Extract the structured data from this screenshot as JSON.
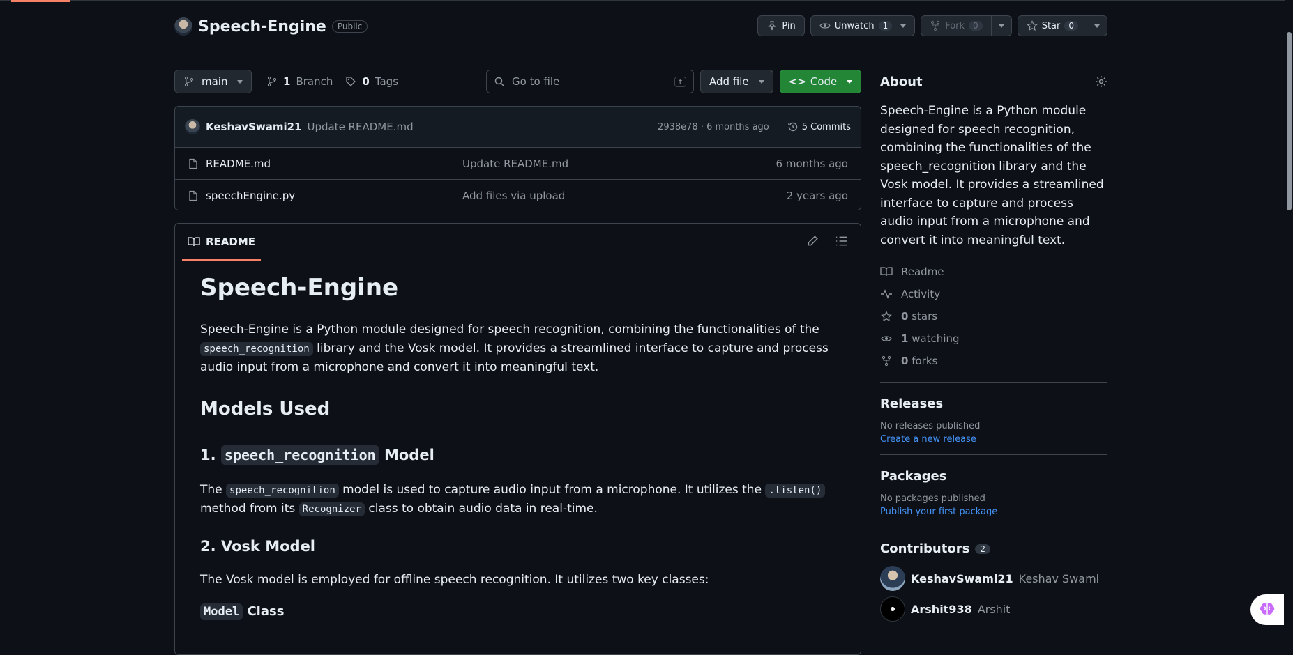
{
  "repo": {
    "name": "Speech-Engine",
    "visibility": "Public",
    "actions": {
      "pin": "Pin",
      "unwatch": "Unwatch",
      "watch_count": "1",
      "fork": "Fork",
      "fork_count": "0",
      "star": "Star",
      "star_count": "0"
    }
  },
  "toolbar": {
    "branch": "main",
    "branch_count": "1",
    "branch_label": "Branch",
    "tag_count": "0",
    "tag_label": "Tags",
    "goto_placeholder": "Go to file",
    "goto_shortcut": "t",
    "add_file": "Add file",
    "code": "Code"
  },
  "latest_commit": {
    "author": "KeshavSwami21",
    "message": "Update README.md",
    "sha_time": "2938e78 · 6 months ago",
    "commits": "5 Commits"
  },
  "files": [
    {
      "name": "README.md",
      "message": "Update README.md",
      "time": "6 months ago"
    },
    {
      "name": "speechEngine.py",
      "message": "Add files via upload",
      "time": "2 years ago"
    }
  ],
  "readme": {
    "tab": "README",
    "h1": "Speech-Engine",
    "intro_1": "Speech-Engine is a Python module designed for speech recognition, combining the functionalities of the",
    "intro_code": "speech_recognition",
    "intro_2": " library and the Vosk model. It provides a streamlined interface to capture and process audio input from a microphone and convert it into meaningful text.",
    "h2_models": "Models Used",
    "h3_1_prefix": "1. ",
    "h3_1_code": "speech_recognition",
    "h3_1_suffix": " Model",
    "p1_a": "The ",
    "p1_code1": "speech_recognition",
    "p1_b": " model is used to capture audio input from a microphone. It utilizes the ",
    "p1_code2": ".listen()",
    "p1_c": " method from its ",
    "p1_code3": "Recognizer",
    "p1_d": " class to obtain audio data in real-time.",
    "h3_2": "2. Vosk Model",
    "p2": "The Vosk model is employed for offline speech recognition. It utilizes two key classes:",
    "h4_code": "Model",
    "h4_suffix": " Class"
  },
  "sidebar": {
    "about_title": "About",
    "about_desc": "Speech-Engine is a Python module designed for speech recognition, combining the functionalities of the speech_recognition library and the Vosk model. It provides a streamlined interface to capture and process audio input from a microphone and convert it into meaningful text.",
    "readme": "Readme",
    "activity": "Activity",
    "stars_count": "0",
    "stars_label": "stars",
    "watching_count": "1",
    "watching_label": "watching",
    "forks_count": "0",
    "forks_label": "forks",
    "releases_title": "Releases",
    "releases_none": "No releases published",
    "releases_link": "Create a new release",
    "packages_title": "Packages",
    "packages_none": "No packages published",
    "packages_link": "Publish your first package",
    "contributors_title": "Contributors",
    "contributors_count": "2",
    "contributors": [
      {
        "login": "KeshavSwami21",
        "name": "Keshav Swami"
      },
      {
        "login": "Arshit938",
        "name": "Arshit"
      }
    ]
  },
  "colors": {
    "background": "#0d1117",
    "accent_green": "#238636",
    "link": "#4493f8",
    "tab_underline": "#f78166"
  }
}
